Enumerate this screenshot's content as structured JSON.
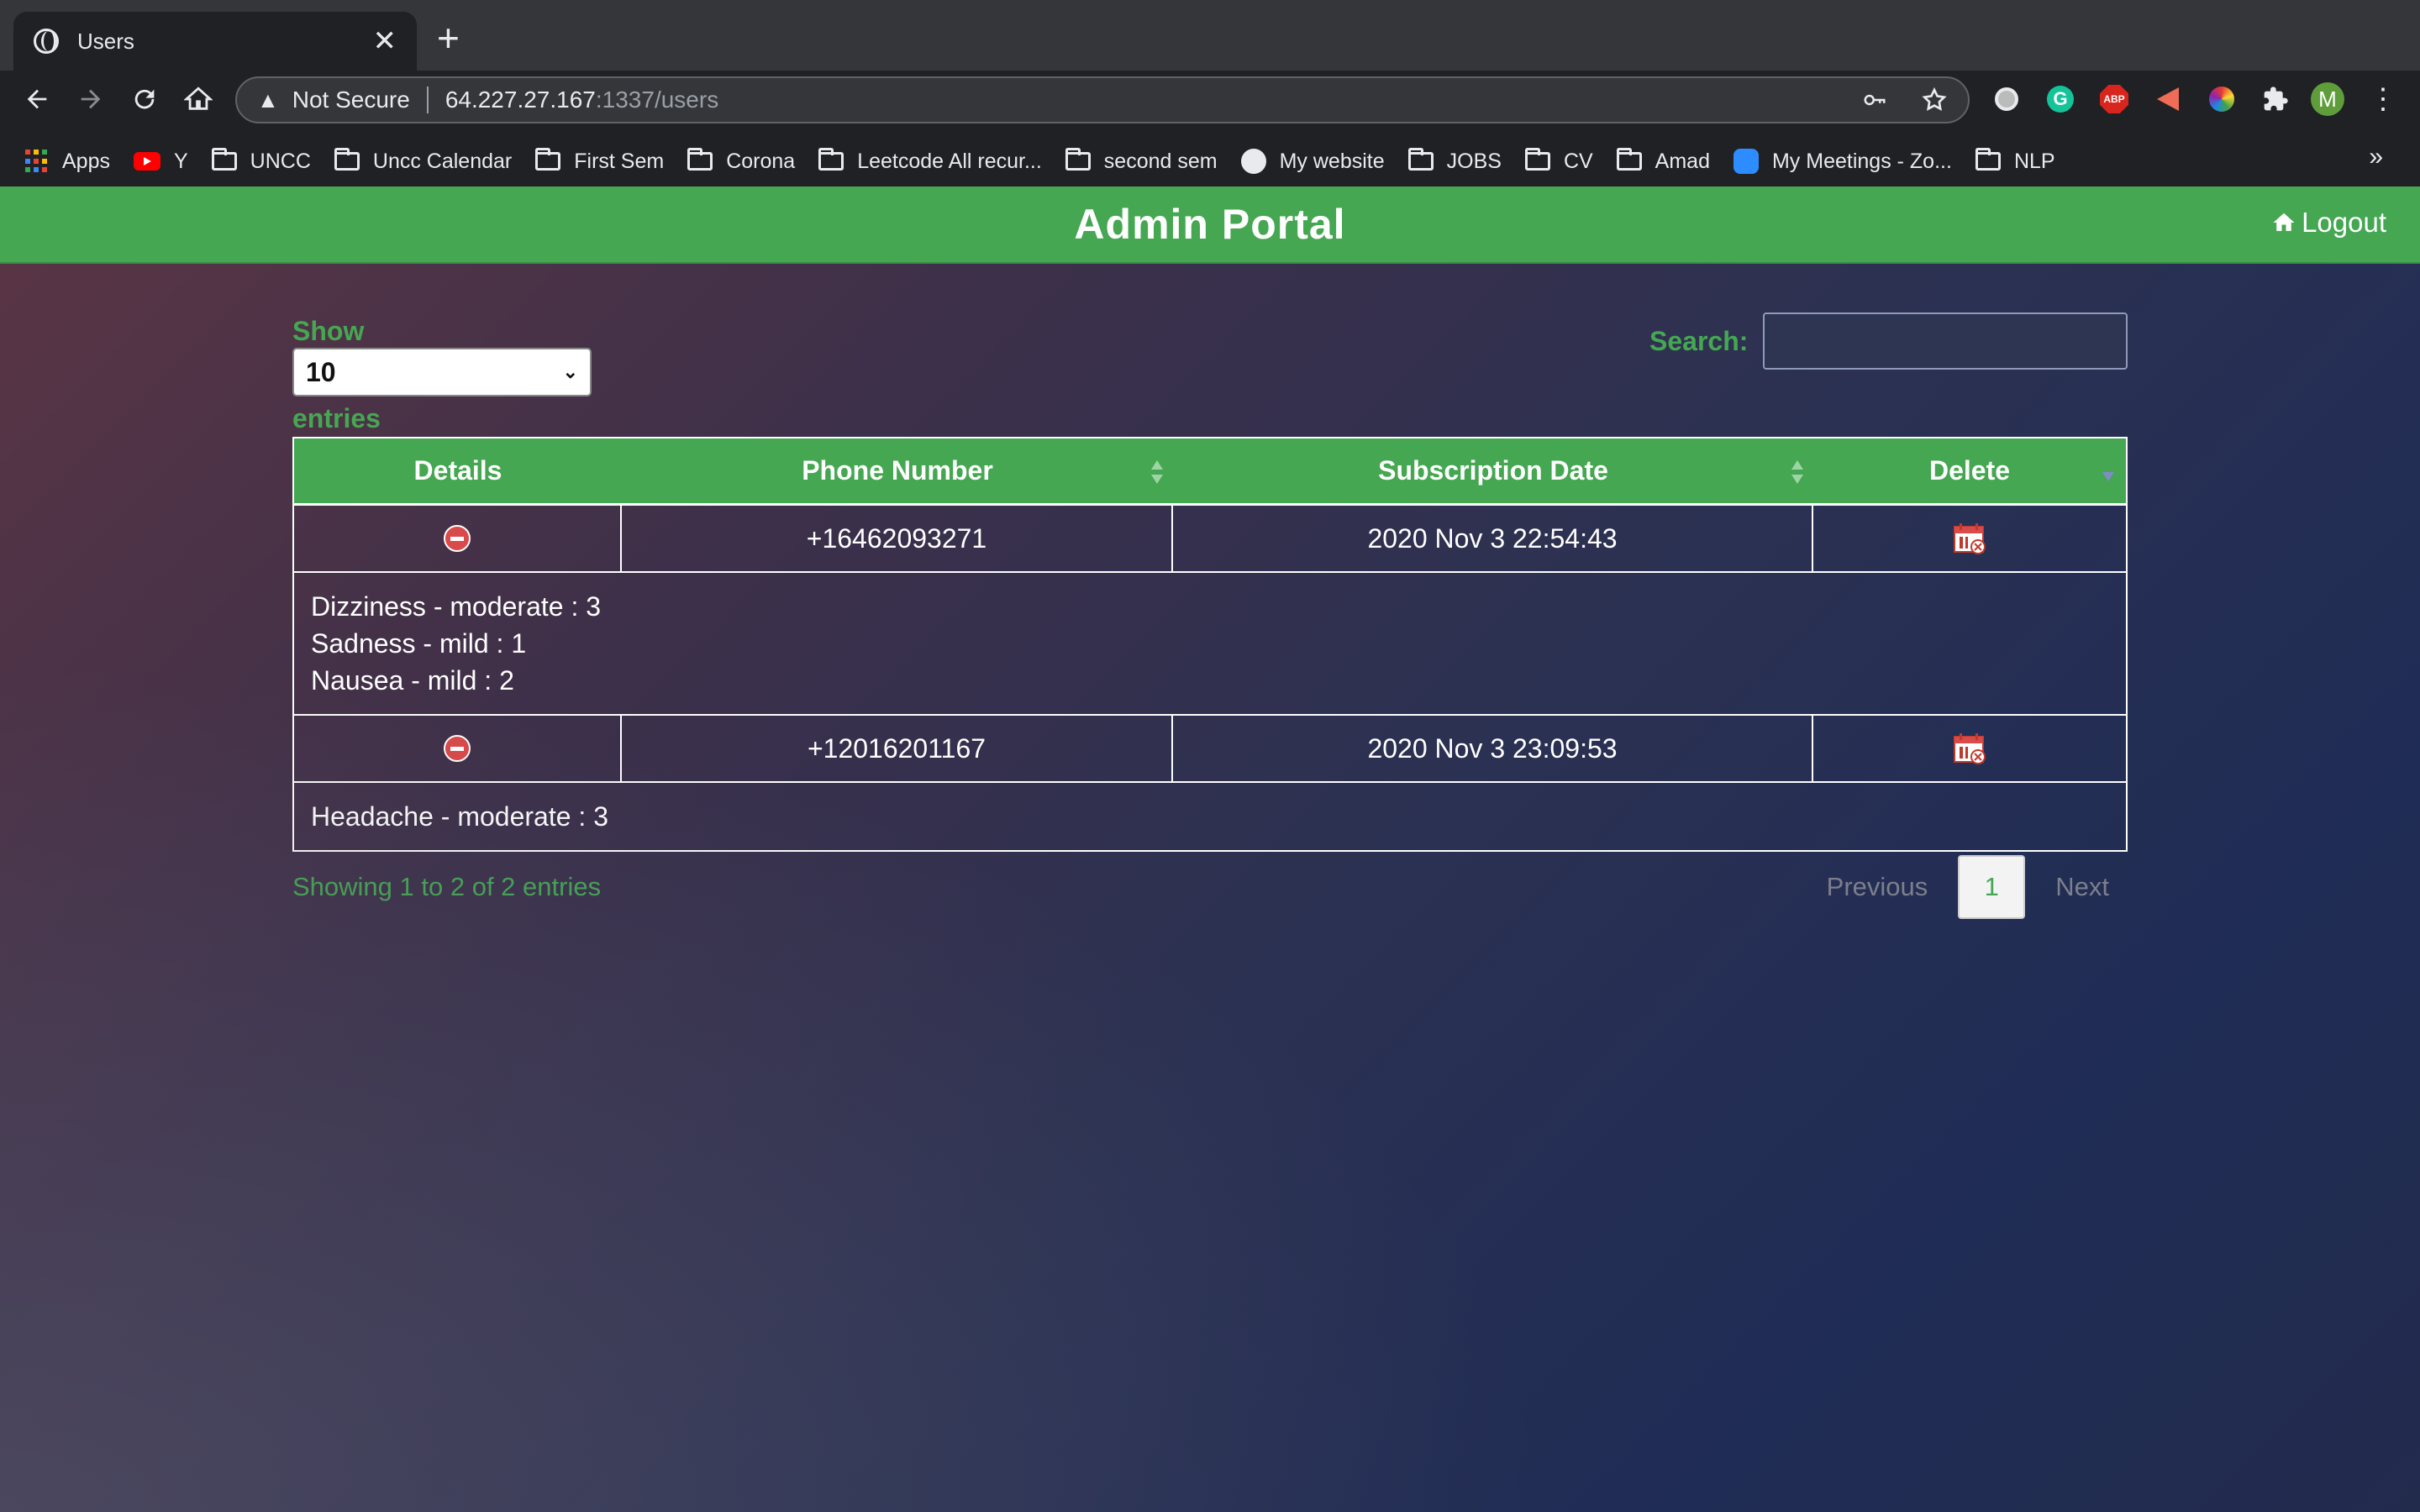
{
  "browser": {
    "tab_title": "Users",
    "security_label": "Not Secure",
    "url_host": "64.227.27.167",
    "url_path": ":1337/users",
    "profile_initial": "M",
    "bookmarks": [
      {
        "label": "Apps",
        "icon": "apps-grid-icon"
      },
      {
        "label": "Y",
        "icon": "youtube-icon"
      },
      {
        "label": "UNCC",
        "icon": "folder-icon"
      },
      {
        "label": "Uncc Calendar",
        "icon": "folder-icon"
      },
      {
        "label": "First Sem",
        "icon": "folder-icon"
      },
      {
        "label": "Corona",
        "icon": "folder-icon"
      },
      {
        "label": "Leetcode All recur...",
        "icon": "folder-icon"
      },
      {
        "label": "second sem",
        "icon": "folder-icon"
      },
      {
        "label": "My website",
        "icon": "globe-icon"
      },
      {
        "label": "JOBS",
        "icon": "folder-icon"
      },
      {
        "label": "CV",
        "icon": "folder-icon"
      },
      {
        "label": "Amad",
        "icon": "folder-icon"
      },
      {
        "label": "My Meetings - Zo...",
        "icon": "zoom-icon"
      },
      {
        "label": "NLP",
        "icon": "folder-icon"
      }
    ],
    "more_bookmarks": "»"
  },
  "header": {
    "title": "Admin Portal",
    "logout_label": "Logout"
  },
  "controls": {
    "show_label": "Show",
    "page_size": "10",
    "entries_label": "entries",
    "search_label": "Search:",
    "search_value": ""
  },
  "table": {
    "columns": [
      "Details",
      "Phone Number",
      "Subscription Date",
      "Delete"
    ],
    "rows": [
      {
        "phone": "+16462093271",
        "date": "2020 Nov 3 22:54:43",
        "details": [
          "Dizziness - moderate : 3",
          "Sadness - mild : 1",
          "Nausea - mild : 2"
        ]
      },
      {
        "phone": "+12016201167",
        "date": "2020 Nov 3 23:09:53",
        "details": [
          "Headache - moderate : 3"
        ]
      }
    ]
  },
  "footer": {
    "info": "Showing 1 to 2 of 2 entries",
    "previous": "Previous",
    "current_page": "1",
    "next": "Next"
  },
  "colors": {
    "accent": "#45a752",
    "delete_red": "#d94a4a"
  }
}
